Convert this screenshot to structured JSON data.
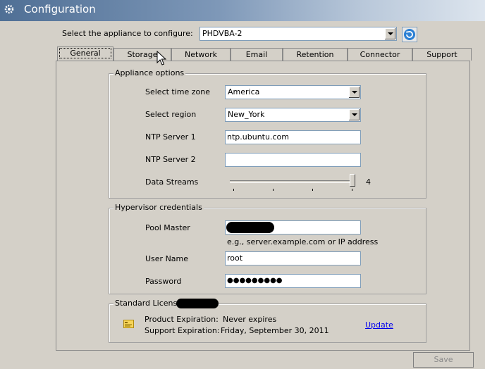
{
  "window": {
    "title": "Configuration"
  },
  "appliance": {
    "label": "Select the appliance to configure:",
    "value": "PHDVBA-2"
  },
  "tabs": [
    {
      "label": "General"
    },
    {
      "label": "Storage"
    },
    {
      "label": "Network"
    },
    {
      "label": "Email"
    },
    {
      "label": "Retention"
    },
    {
      "label": "Connector"
    },
    {
      "label": "Support"
    }
  ],
  "appliance_options": {
    "legend": "Appliance options",
    "time_zone_label": "Select time zone",
    "time_zone_value": "America",
    "region_label": "Select region",
    "region_value": "New_York",
    "ntp1_label": "NTP Server 1",
    "ntp1_value": "ntp.ubuntu.com",
    "ntp2_label": "NTP Server 2",
    "ntp2_value": "",
    "streams_label": "Data Streams",
    "streams_value": "4"
  },
  "hypervisor": {
    "legend": "Hypervisor credentials",
    "pool_master_label": "Pool Master",
    "pool_master_hint": "e.g., server.example.com or IP address",
    "username_label": "User Name",
    "username_value": "root",
    "password_label": "Password",
    "password_value": "●●●●●●●●●"
  },
  "license": {
    "legend": "Standard License:",
    "product_label": "Product Expiration:",
    "product_value": "Never expires",
    "support_label": "Support Expiration:",
    "support_value": "Friday, September 30, 2011",
    "update_link": "Update"
  },
  "footer": {
    "save_label": "Save"
  }
}
